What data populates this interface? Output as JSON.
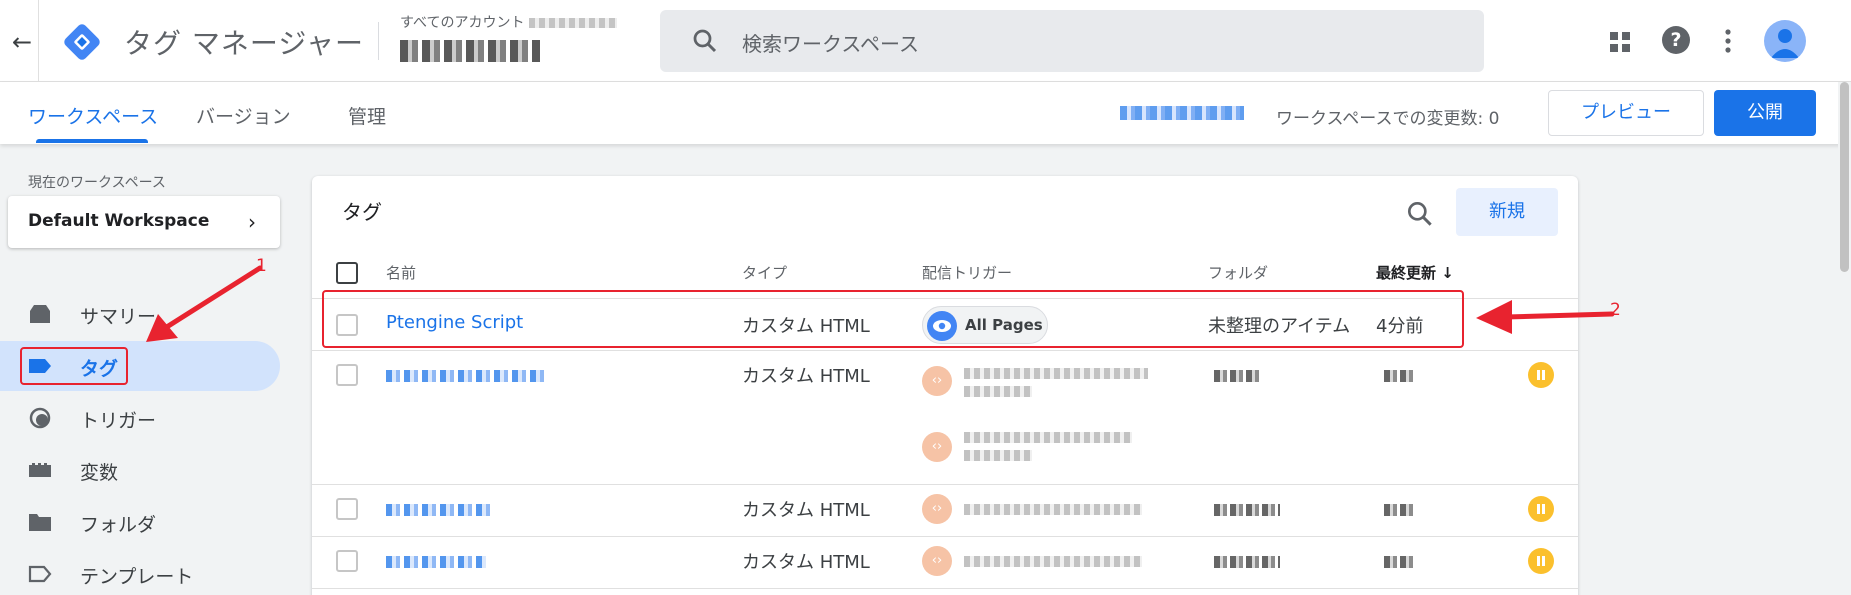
{
  "header": {
    "app_title": "タグ マネージャー",
    "account_label": "すべてのアカウント",
    "search_placeholder": "検索ワークスペース"
  },
  "subnav": {
    "tabs": [
      {
        "label": "ワークスペース",
        "active": true
      },
      {
        "label": "バージョン",
        "active": false
      },
      {
        "label": "管理",
        "active": false
      }
    ],
    "changes_text": "ワークスペースでの変更数: 0",
    "preview_label": "プレビュー",
    "publish_label": "公開"
  },
  "sidebar": {
    "current_ws_label": "現在のワークスペース",
    "workspace_name": "Default Workspace",
    "items": [
      {
        "label": "サマリー",
        "icon": "summary-icon"
      },
      {
        "label": "タグ",
        "icon": "tag-icon",
        "active": true
      },
      {
        "label": "トリガー",
        "icon": "trigger-icon"
      },
      {
        "label": "変数",
        "icon": "variables-icon"
      },
      {
        "label": "フォルダ",
        "icon": "folder-icon"
      },
      {
        "label": "テンプレート",
        "icon": "template-icon"
      }
    ]
  },
  "main": {
    "title": "タグ",
    "new_label": "新規",
    "columns": [
      "名前",
      "タイプ",
      "配信トリガー",
      "フォルダ",
      "最終更新"
    ],
    "sort_indicator": "↓",
    "rows": [
      {
        "name": "Ptengine Script",
        "type": "カスタム HTML",
        "trigger": "All Pages",
        "folder": "未整理のアイテム",
        "updated": "4分前"
      },
      {
        "type": "カスタム HTML"
      },
      {
        "type": "カスタム HTML"
      },
      {
        "type": "カスタム HTML"
      }
    ]
  },
  "annotations": {
    "step1": "1",
    "step2": "2"
  },
  "colors": {
    "accent": "#1a73e8",
    "highlight": "#e8232f",
    "paused": "#fbc02d"
  }
}
